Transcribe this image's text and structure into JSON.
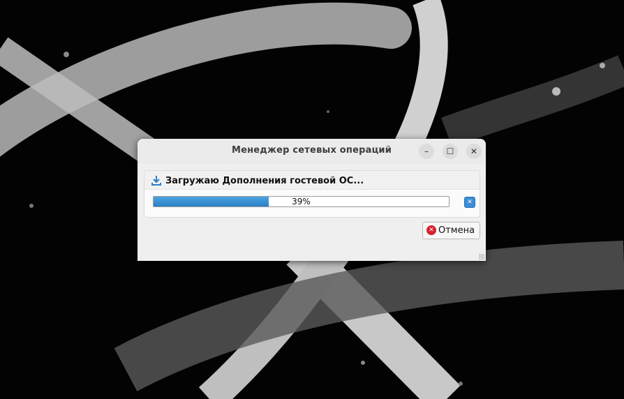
{
  "window": {
    "title": "Менеджер сетевых операций",
    "minimize_icon": "minimize-icon",
    "maximize_icon": "maximize-icon",
    "close_icon": "close-icon"
  },
  "operation": {
    "title": "Загружаю Дополнения гостевой ОС...",
    "icon": "download-icon",
    "progress_fraction": 0.39,
    "progress_text": "39%",
    "cancel_icon": "cancel-operation-icon"
  },
  "footer": {
    "cancel_label": "Отмена",
    "cancel_icon": "cancel-icon"
  },
  "colors": {
    "progress": "#2b7fc6",
    "cancel": "#d3232f",
    "window_bg": "#efefef"
  }
}
